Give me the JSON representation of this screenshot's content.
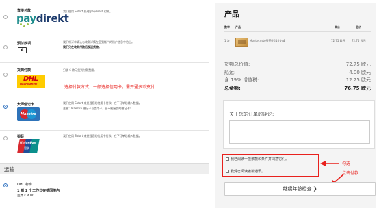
{
  "payment_methods": [
    {
      "name": "直接付款",
      "desc": [
        "我们使用 Sofort 处理 paydirekt 付款。"
      ],
      "logo": "paydirekt"
    },
    {
      "name": "预付款项",
      "desc": [
        "我们将订单确认与收款详情在您到帐户的账户信息中给出。",
        "我们只在收到付款后发送货物。"
      ],
      "logo": "cash"
    },
    {
      "name": "货到付款",
      "desc": [
        "另收 6 欧元货到付款费用。"
      ],
      "logo": "dhl"
    },
    {
      "name": "大师借记卡",
      "desc": [
        "我们使用 Sofort 来处理您的信用卡付款。在下订单后输入数据。",
        "注意：Maestro 借记卡与信用卡，它不能接受的借记卡!"
      ],
      "logo": "maestro",
      "selected": true
    },
    {
      "name": "银联",
      "desc": [
        "我们使用 Sofort 来处理您的信用卡付款。在下订单后输入数据。"
      ],
      "logo": "unionpay"
    }
  ],
  "logos": {
    "paydirekt_a": "pay",
    "paydirekt_b": "direkt",
    "cash": "€",
    "dhl": "DHL",
    "dhl_sub": "NACHNAHME",
    "maestro": "Maestro",
    "unionpay": "UnionPay",
    "unionpay_sub": "银联"
  },
  "red_note": "选择付款方式，一般选择信用卡，需开通多币支付",
  "shipping": {
    "title": "运输",
    "method": "DHL 标准",
    "eta": "1 到 2 个工作日在德国境内",
    "fee": "运费 € 4.00"
  },
  "order": {
    "title": "产品",
    "headers": {
      "qty": "数字",
      "product": "产品",
      "unit": "单价",
      "total": "总价"
    },
    "item": {
      "qty": "1 次",
      "name": "Montecristo雪茄6号10支/盒",
      "unit_price": "72.75 欧元",
      "total_price": "72.75 欧元"
    },
    "summary": [
      {
        "label": "货物总价值:",
        "value": "72.75 欧元"
      },
      {
        "label": "船运:",
        "value": "4.00 欧元"
      },
      {
        "label": "含 19% 增值税:",
        "value": "12.25 欧元"
      },
      {
        "label": "总金额:",
        "value": "76.75 欧元"
      }
    ],
    "comment_label": "关于您的订单的评论:",
    "checkbox_terms": "我已阅读一般条款和条件并同意它们。",
    "checkbox_withdrawal": "我受已阅读撤销通讯。",
    "annotation_check": "勾选",
    "annotation_click": "点击付款",
    "continue_button": "继续年龄检查 ❯"
  },
  "colors": {
    "annotation": "#e8211d",
    "panel_bg": "#f4f4f4",
    "radio_selected": "#2a6ebf"
  }
}
